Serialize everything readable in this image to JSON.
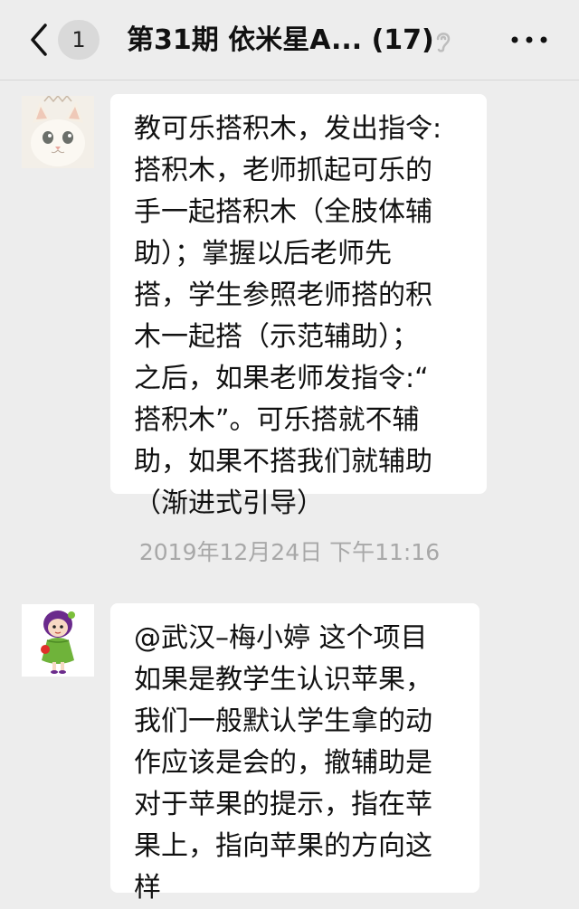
{
  "header": {
    "back_icon": "chevron-left-icon",
    "unread_count": "1",
    "title": "第31期 依米星A... (17)",
    "mute_icon": "ear-icon",
    "more_icon": "more-dots-icon"
  },
  "messages": [
    {
      "avatar": "cat-avatar",
      "lines": [
        "教可乐搭积木，发出指令:",
        "搭积木，老师抓起可乐的",
        "手一起搭积木（全肢体辅",
        "助）；掌握以后老师先",
        "搭，学生参照老师搭的积",
        "木一起搭（示范辅助）；",
        "之后，如果老师发指令:“",
        "搭积木”。可乐搭就不辅",
        "助，如果不搭我们就辅助",
        "（渐进式引导）"
      ]
    },
    {
      "avatar": "cartoon-girl-avatar",
      "lines": [
        "@武汉–梅小婷 这个项目",
        "如果是教学生认识苹果，",
        "我们一般默认学生拿的动",
        "作应该是会的，撤辅助是",
        "对于苹果的提示，指在苹",
        "果上，指向苹果的方向这",
        "样"
      ]
    }
  ],
  "timestamp": "2019年12月24日 下午11:16"
}
